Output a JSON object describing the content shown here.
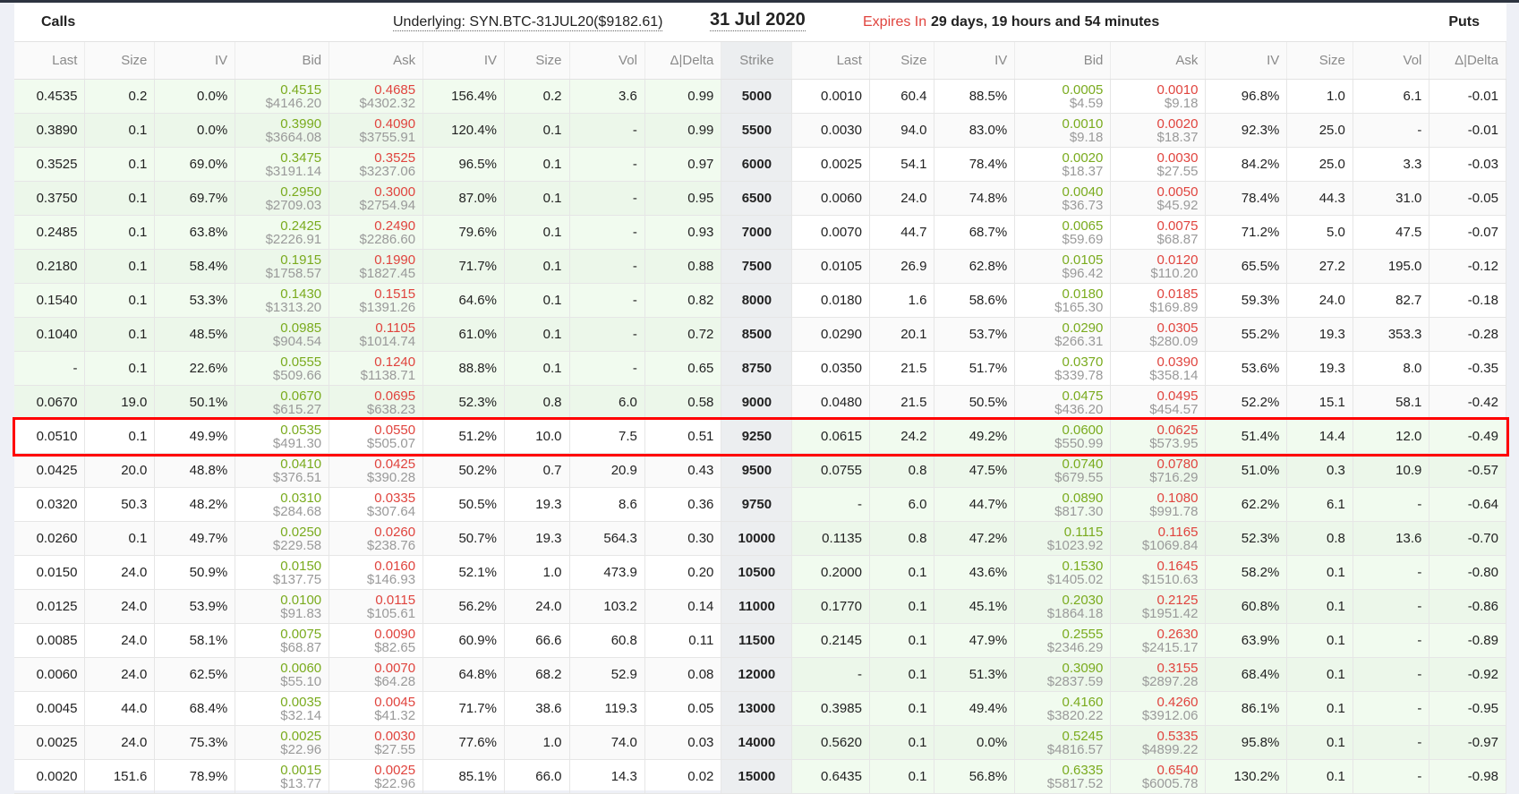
{
  "header": {
    "calls": "Calls",
    "underlying": "Underlying: SYN.BTC-31JUL20($9182.61)",
    "underlying_price": 9182.61,
    "date": "31 Jul 2020",
    "expires_label": "Expires In",
    "expires_value": "29 days, 19 hours and 54 minutes",
    "puts": "Puts"
  },
  "columns": [
    "Last",
    "Size",
    "IV",
    "Bid",
    "Ask",
    "IV",
    "Size",
    "Vol",
    "Δ|Delta",
    "Strike",
    "Last",
    "Size",
    "IV",
    "Bid",
    "Ask",
    "IV",
    "Size",
    "Vol",
    "Δ|Delta"
  ],
  "highlighted_strike": "9250",
  "colors": {
    "bid": "#7aab1e",
    "ask": "#e0443e",
    "itm": "#f1fbef",
    "highlight": "#ff0000"
  },
  "rows": [
    {
      "strike": "5000",
      "call": [
        "0.4535",
        "0.2",
        "0.0%",
        "0.4515",
        "$4146.20",
        "0.4685",
        "$4302.32",
        "156.4%",
        "0.2",
        "3.6",
        "0.99"
      ],
      "put": [
        "0.0010",
        "60.4",
        "88.5%",
        "0.0005",
        "$4.59",
        "0.0010",
        "$9.18",
        "96.8%",
        "1.0",
        "6.1",
        "-0.01"
      ]
    },
    {
      "strike": "5500",
      "call": [
        "0.3890",
        "0.1",
        "0.0%",
        "0.3990",
        "$3664.08",
        "0.4090",
        "$3755.91",
        "120.4%",
        "0.1",
        "-",
        "0.99"
      ],
      "put": [
        "0.0030",
        "94.0",
        "83.0%",
        "0.0010",
        "$9.18",
        "0.0020",
        "$18.37",
        "92.3%",
        "25.0",
        "-",
        "-0.01"
      ]
    },
    {
      "strike": "6000",
      "call": [
        "0.3525",
        "0.1",
        "69.0%",
        "0.3475",
        "$3191.14",
        "0.3525",
        "$3237.06",
        "96.5%",
        "0.1",
        "-",
        "0.97"
      ],
      "put": [
        "0.0025",
        "54.1",
        "78.4%",
        "0.0020",
        "$18.37",
        "0.0030",
        "$27.55",
        "84.2%",
        "25.0",
        "3.3",
        "-0.03"
      ]
    },
    {
      "strike": "6500",
      "call": [
        "0.3750",
        "0.1",
        "69.7%",
        "0.2950",
        "$2709.03",
        "0.3000",
        "$2754.94",
        "87.0%",
        "0.1",
        "-",
        "0.95"
      ],
      "put": [
        "0.0060",
        "24.0",
        "74.8%",
        "0.0040",
        "$36.73",
        "0.0050",
        "$45.92",
        "78.4%",
        "44.3",
        "31.0",
        "-0.05"
      ]
    },
    {
      "strike": "7000",
      "call": [
        "0.2485",
        "0.1",
        "63.8%",
        "0.2425",
        "$2226.91",
        "0.2490",
        "$2286.60",
        "79.6%",
        "0.1",
        "-",
        "0.93"
      ],
      "put": [
        "0.0070",
        "44.7",
        "68.7%",
        "0.0065",
        "$59.69",
        "0.0075",
        "$68.87",
        "71.2%",
        "5.0",
        "47.5",
        "-0.07"
      ]
    },
    {
      "strike": "7500",
      "call": [
        "0.2180",
        "0.1",
        "58.4%",
        "0.1915",
        "$1758.57",
        "0.1990",
        "$1827.45",
        "71.7%",
        "0.1",
        "-",
        "0.88"
      ],
      "put": [
        "0.0105",
        "26.9",
        "62.8%",
        "0.0105",
        "$96.42",
        "0.0120",
        "$110.20",
        "65.5%",
        "27.2",
        "195.0",
        "-0.12"
      ]
    },
    {
      "strike": "8000",
      "call": [
        "0.1540",
        "0.1",
        "53.3%",
        "0.1430",
        "$1313.20",
        "0.1515",
        "$1391.26",
        "64.6%",
        "0.1",
        "-",
        "0.82"
      ],
      "put": [
        "0.0180",
        "1.6",
        "58.6%",
        "0.0180",
        "$165.30",
        "0.0185",
        "$169.89",
        "59.3%",
        "24.0",
        "82.7",
        "-0.18"
      ]
    },
    {
      "strike": "8500",
      "call": [
        "0.1040",
        "0.1",
        "48.5%",
        "0.0985",
        "$904.54",
        "0.1105",
        "$1014.74",
        "61.0%",
        "0.1",
        "-",
        "0.72"
      ],
      "put": [
        "0.0290",
        "20.1",
        "53.7%",
        "0.0290",
        "$266.31",
        "0.0305",
        "$280.09",
        "55.2%",
        "19.3",
        "353.3",
        "-0.28"
      ]
    },
    {
      "strike": "8750",
      "call": [
        "-",
        "0.1",
        "22.6%",
        "0.0555",
        "$509.66",
        "0.1240",
        "$1138.71",
        "88.8%",
        "0.1",
        "-",
        "0.65"
      ],
      "put": [
        "0.0350",
        "21.5",
        "51.7%",
        "0.0370",
        "$339.78",
        "0.0390",
        "$358.14",
        "53.6%",
        "19.3",
        "8.0",
        "-0.35"
      ]
    },
    {
      "strike": "9000",
      "call": [
        "0.0670",
        "19.0",
        "50.1%",
        "0.0670",
        "$615.27",
        "0.0695",
        "$638.23",
        "52.3%",
        "0.8",
        "6.0",
        "0.58"
      ],
      "put": [
        "0.0480",
        "21.5",
        "50.5%",
        "0.0475",
        "$436.20",
        "0.0495",
        "$454.57",
        "52.2%",
        "15.1",
        "58.1",
        "-0.42"
      ]
    },
    {
      "strike": "9250",
      "call": [
        "0.0510",
        "0.1",
        "49.9%",
        "0.0535",
        "$491.30",
        "0.0550",
        "$505.07",
        "51.2%",
        "10.0",
        "7.5",
        "0.51"
      ],
      "put": [
        "0.0615",
        "24.2",
        "49.2%",
        "0.0600",
        "$550.99",
        "0.0625",
        "$573.95",
        "51.4%",
        "14.4",
        "12.0",
        "-0.49"
      ]
    },
    {
      "strike": "9500",
      "call": [
        "0.0425",
        "20.0",
        "48.8%",
        "0.0410",
        "$376.51",
        "0.0425",
        "$390.28",
        "50.2%",
        "0.7",
        "20.9",
        "0.43"
      ],
      "put": [
        "0.0755",
        "0.8",
        "47.5%",
        "0.0740",
        "$679.55",
        "0.0780",
        "$716.29",
        "51.0%",
        "0.3",
        "10.9",
        "-0.57"
      ]
    },
    {
      "strike": "9750",
      "call": [
        "0.0320",
        "50.3",
        "48.2%",
        "0.0310",
        "$284.68",
        "0.0335",
        "$307.64",
        "50.5%",
        "19.3",
        "8.6",
        "0.36"
      ],
      "put": [
        "-",
        "6.0",
        "44.7%",
        "0.0890",
        "$817.30",
        "0.1080",
        "$991.78",
        "62.2%",
        "6.1",
        "-",
        "-0.64"
      ]
    },
    {
      "strike": "10000",
      "call": [
        "0.0260",
        "0.1",
        "49.7%",
        "0.0250",
        "$229.58",
        "0.0260",
        "$238.76",
        "50.7%",
        "19.3",
        "564.3",
        "0.30"
      ],
      "put": [
        "0.1135",
        "0.8",
        "47.2%",
        "0.1115",
        "$1023.92",
        "0.1165",
        "$1069.84",
        "52.3%",
        "0.8",
        "13.6",
        "-0.70"
      ]
    },
    {
      "strike": "10500",
      "call": [
        "0.0150",
        "24.0",
        "50.9%",
        "0.0150",
        "$137.75",
        "0.0160",
        "$146.93",
        "52.1%",
        "1.0",
        "473.9",
        "0.20"
      ],
      "put": [
        "0.2000",
        "0.1",
        "43.6%",
        "0.1530",
        "$1405.02",
        "0.1645",
        "$1510.63",
        "58.2%",
        "0.1",
        "-",
        "-0.80"
      ]
    },
    {
      "strike": "11000",
      "call": [
        "0.0125",
        "24.0",
        "53.9%",
        "0.0100",
        "$91.83",
        "0.0115",
        "$105.61",
        "56.2%",
        "24.0",
        "103.2",
        "0.14"
      ],
      "put": [
        "0.1770",
        "0.1",
        "45.1%",
        "0.2030",
        "$1864.18",
        "0.2125",
        "$1951.42",
        "60.8%",
        "0.1",
        "-",
        "-0.86"
      ]
    },
    {
      "strike": "11500",
      "call": [
        "0.0085",
        "24.0",
        "58.1%",
        "0.0075",
        "$68.87",
        "0.0090",
        "$82.65",
        "60.9%",
        "66.6",
        "60.8",
        "0.11"
      ],
      "put": [
        "0.2145",
        "0.1",
        "47.9%",
        "0.2555",
        "$2346.29",
        "0.2630",
        "$2415.17",
        "63.9%",
        "0.1",
        "-",
        "-0.89"
      ]
    },
    {
      "strike": "12000",
      "call": [
        "0.0060",
        "24.0",
        "62.5%",
        "0.0060",
        "$55.10",
        "0.0070",
        "$64.28",
        "64.8%",
        "68.2",
        "52.9",
        "0.08"
      ],
      "put": [
        "-",
        "0.1",
        "51.3%",
        "0.3090",
        "$2837.59",
        "0.3155",
        "$2897.28",
        "68.4%",
        "0.1",
        "-",
        "-0.92"
      ]
    },
    {
      "strike": "13000",
      "call": [
        "0.0045",
        "44.0",
        "68.4%",
        "0.0035",
        "$32.14",
        "0.0045",
        "$41.32",
        "71.7%",
        "38.6",
        "119.3",
        "0.05"
      ],
      "put": [
        "0.3985",
        "0.1",
        "49.4%",
        "0.4160",
        "$3820.22",
        "0.4260",
        "$3912.06",
        "86.1%",
        "0.1",
        "-",
        "-0.95"
      ]
    },
    {
      "strike": "14000",
      "call": [
        "0.0025",
        "24.0",
        "75.3%",
        "0.0025",
        "$22.96",
        "0.0030",
        "$27.55",
        "77.6%",
        "1.0",
        "74.0",
        "0.03"
      ],
      "put": [
        "0.5620",
        "0.1",
        "0.0%",
        "0.5245",
        "$4816.57",
        "0.5335",
        "$4899.22",
        "95.8%",
        "0.1",
        "-",
        "-0.97"
      ]
    },
    {
      "strike": "15000",
      "call": [
        "0.0020",
        "151.6",
        "78.9%",
        "0.0015",
        "$13.77",
        "0.0025",
        "$22.96",
        "85.1%",
        "66.0",
        "14.3",
        "0.02"
      ],
      "put": [
        "0.6435",
        "0.1",
        "56.8%",
        "0.6335",
        "$5817.52",
        "0.6540",
        "$6005.78",
        "130.2%",
        "0.1",
        "-",
        "-0.98"
      ]
    }
  ]
}
